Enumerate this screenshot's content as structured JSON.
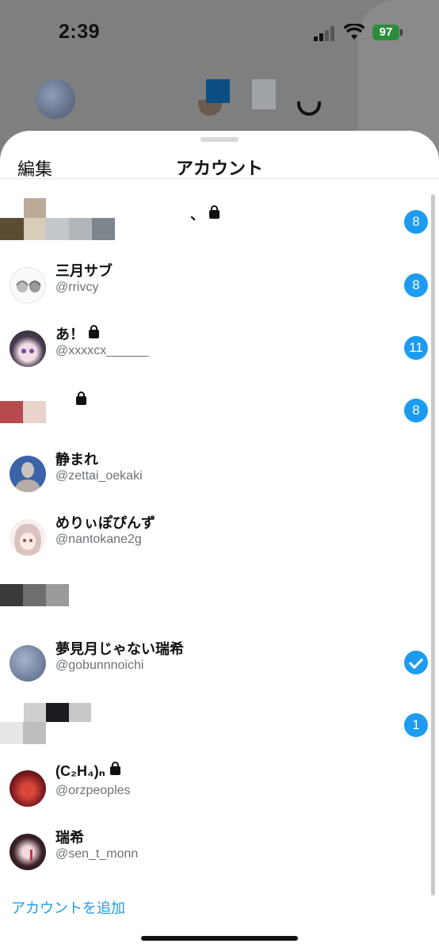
{
  "status_bar": {
    "time": "2:39",
    "battery": "97"
  },
  "sheet": {
    "edit_label": "編集",
    "title": "アカウント",
    "add_account_label": "アカウントを追加"
  },
  "accounts": [
    {
      "name": "、",
      "handle": "",
      "locked": true,
      "badge": "8"
    },
    {
      "name": "三月サブ",
      "handle": "@rrivcy",
      "locked": false,
      "badge": "8"
    },
    {
      "name": "あ！",
      "handle": "@xxxxcx______",
      "locked": true,
      "badge": "11"
    },
    {
      "name": "",
      "handle": "",
      "locked": true,
      "badge": "8"
    },
    {
      "name": "静まれ",
      "handle": "@zettai_oekaki",
      "locked": false,
      "badge": ""
    },
    {
      "name": "めりぃぽぴんず",
      "handle": "@nantokane2g",
      "locked": false,
      "badge": ""
    },
    {
      "name": "",
      "handle": "",
      "locked": false,
      "badge": ""
    },
    {
      "name": "夢見月じゃない瑞希",
      "handle": "@gobunnnoichi",
      "locked": false,
      "badge": "",
      "current": true
    },
    {
      "name": "",
      "handle": "",
      "locked": false,
      "badge": "1"
    },
    {
      "name": "(C₂H₄)ₙ",
      "handle": "@orzpeoples",
      "locked": true,
      "badge": ""
    },
    {
      "name": "瑞希",
      "handle": "@sen_t_monn",
      "locked": false,
      "badge": ""
    }
  ],
  "colors": {
    "accent": "#1d9bf0",
    "badge": "#1d9bf0"
  },
  "icons": {
    "lock": "lock-icon",
    "check": "checkmark-icon"
  }
}
